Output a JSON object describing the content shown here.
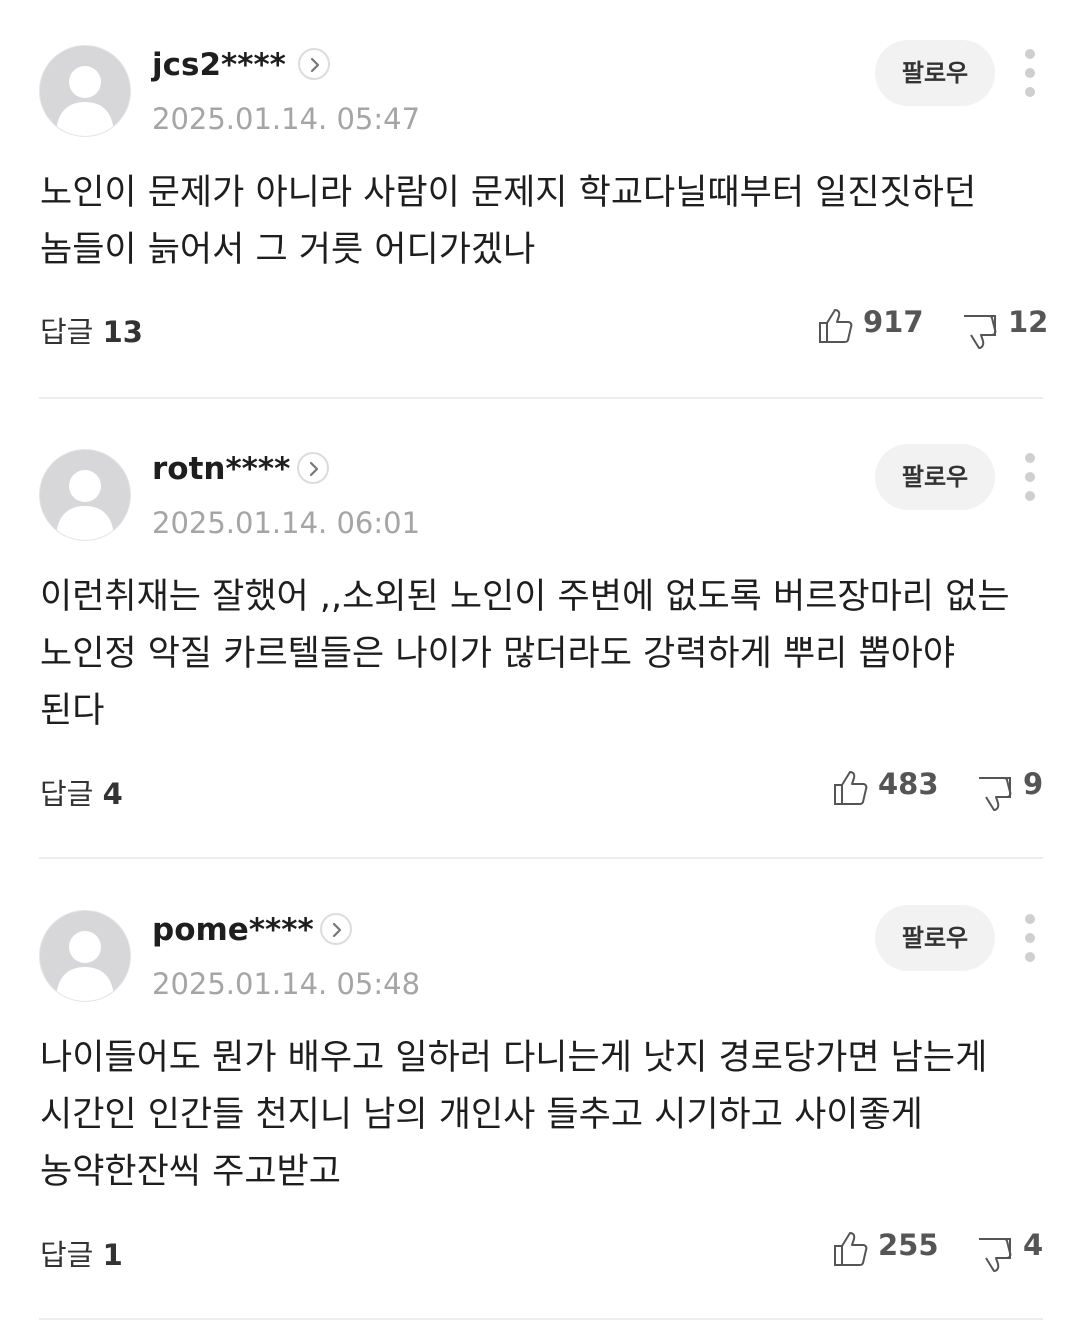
{
  "follow_label": "팔로우",
  "reply_label": "답글",
  "comments": [
    {
      "username": "jcs2****",
      "timestamp": "2025.01.14. 05:47",
      "text": "노인이 문제가 아니라 사람이 문제지 학교다닐때부터 일진짓하던 놈들이 늙어서 그 거릇 어디가겠나",
      "replies": "13",
      "likes": "917",
      "dislikes": "12"
    },
    {
      "username": "rotn****",
      "timestamp": "2025.01.14. 06:01",
      "text": "이런취재는 잘했어 ,,소외된 노인이 주변에 없도록 버르장마리 없는 노인정 악질 카르텔들은 나이가 많더라도 강력하게 뿌리 뽑아야 된다",
      "replies": "4",
      "likes": "483",
      "dislikes": "9"
    },
    {
      "username": "pome****",
      "timestamp": "2025.01.14. 05:48",
      "text": "나이들어도 뭔가 배우고 일하러 다니는게 낫지 경로당가면 남는게 시간인 인간들 천지니 남의 개인사 들추고 시기하고 사이좋게 농약한잔씩 주고받고",
      "replies": "1",
      "likes": "255",
      "dislikes": "4"
    }
  ]
}
